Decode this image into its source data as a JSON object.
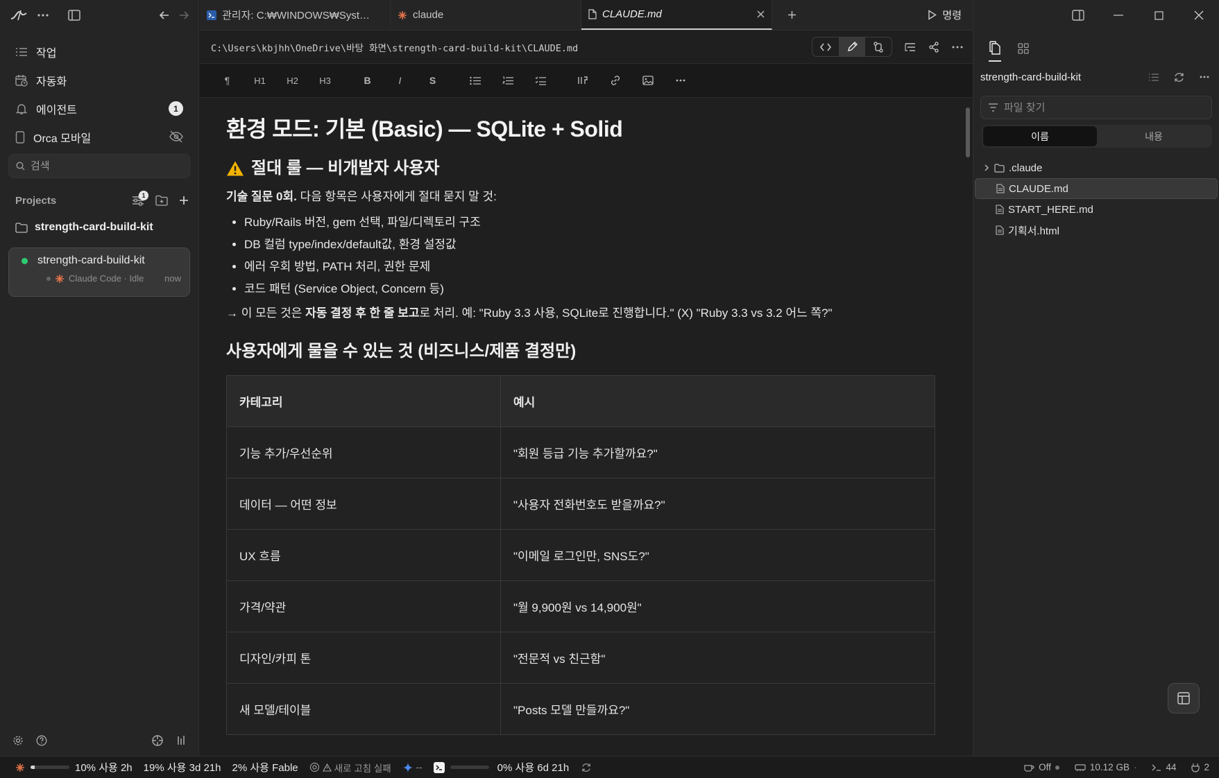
{
  "sidebar": {
    "nav": [
      {
        "label": "작업",
        "icon": "list-icon"
      },
      {
        "label": "자동화",
        "icon": "calendar-clock-icon"
      },
      {
        "label": "에이전트",
        "icon": "bell-icon",
        "badge": "1"
      },
      {
        "label": "Orca 모바일",
        "icon": "mobile-icon"
      }
    ],
    "search_placeholder": "검색",
    "projects_label": "Projects",
    "projects_filter_badge": "1",
    "project_folder": "strength-card-build-kit",
    "workspace": {
      "name": "strength-card-build-kit",
      "session": "Claude Code · Idle",
      "time": "now",
      "status_color": "#2ecc71"
    }
  },
  "tabs": [
    {
      "title": "관리자: C:₩WINDOWS₩Syst…",
      "icon": "terminal-icon"
    },
    {
      "title": "claude",
      "icon": "claude-icon"
    },
    {
      "title": "CLAUDE.md",
      "icon": "file-icon",
      "active": true
    }
  ],
  "run_label": "명령",
  "path": "C:\\Users\\kbjhh\\OneDrive\\바탕 화면\\strength-card-build-kit\\CLAUDE.md",
  "toolbar": [
    "¶",
    "H1",
    "H2",
    "H3",
    "B",
    "I",
    "S"
  ],
  "doc": {
    "h1": "환경 모드: 기본 (Basic) — SQLite + Solid",
    "h2_rule": "절대 룰 — 비개발자 사용자",
    "p1_bold": "기술 질문 0회.",
    "p1_rest": " 다음 항목은 사용자에게 절대 묻지 말 것:",
    "bullets": [
      "Ruby/Rails 버전, gem 선택, 파일/디렉토리 구조",
      "DB 컬럼 type/index/default값, 환경 설정값",
      "에러 우회 방법, PATH 처리, 권한 문제",
      "코드 패턴 (Service Object, Concern 등)"
    ],
    "p2_pre": "→ 이 모든 것은 ",
    "p2_bold": "자동 결정 후 한 줄 보고",
    "p2_post": "로 처리. 예: \"Ruby 3.3 사용, SQLite로 진행합니다.\" (X) \"Ruby 3.3 vs 3.2 어느 쪽?\"",
    "h2_ask": "사용자에게 물을 수 있는 것 (비즈니스/제품 결정만)",
    "table": {
      "headers": [
        "카테고리",
        "예시"
      ],
      "rows": [
        [
          "기능 추가/우선순위",
          "\"회원 등급 기능 추가할까요?\""
        ],
        [
          "데이터 — 어떤 정보",
          "\"사용자 전화번호도 받을까요?\""
        ],
        [
          "UX 흐름",
          "\"이메일 로그인만, SNS도?\""
        ],
        [
          "가격/약관",
          "\"월 9,900원 vs 14,900원\""
        ],
        [
          "디자인/카피 톤",
          "\"전문적 vs 친근함\""
        ],
        [
          "새 모델/테이블",
          "\"Posts 모델 만들까요?\""
        ]
      ]
    }
  },
  "right": {
    "title": "strength-card-build-kit",
    "search_placeholder": "파일 찾기",
    "toggle": [
      "이름",
      "내용"
    ],
    "tree": [
      {
        "name": ".claude",
        "type": "folder"
      },
      {
        "name": "CLAUDE.md",
        "type": "file",
        "selected": true
      },
      {
        "name": "START_HERE.md",
        "type": "file"
      },
      {
        "name": "기획서.html",
        "type": "file"
      }
    ]
  },
  "status": {
    "u1": "10% 사용 2h",
    "u1_fill": 0.1,
    "u2": "19% 사용 3d 21h",
    "u3": "2% 사용 Fable",
    "refresh_fail": "새로 고침 실패",
    "dash": "--",
    "u4": "0% 사용 6d 21h",
    "off": "Off",
    "mem": "10.12 GB",
    "terms": "44",
    "ports": "2"
  }
}
